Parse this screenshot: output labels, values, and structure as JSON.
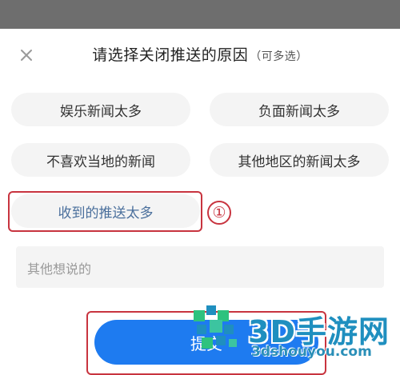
{
  "dialog": {
    "title": "请选择关闭推送的原因",
    "subtitle": "（可多选）",
    "options": [
      {
        "label": "娱乐新闻太多",
        "selected": false
      },
      {
        "label": "负面新闻太多",
        "selected": false
      },
      {
        "label": "不喜欢当地的新闻",
        "selected": false
      },
      {
        "label": "其他地区的新闻太多",
        "selected": false
      },
      {
        "label": "收到的推送太多",
        "selected": true
      }
    ],
    "feedback_placeholder": "其他想说的",
    "submit_label": "提交"
  },
  "annotation": {
    "step_marker": "①",
    "highlight_color": "#c8343f"
  },
  "watermark": {
    "brand": "3D手游网",
    "url": "3dshouyou.com"
  },
  "colors": {
    "accent": "#1e7bf0",
    "selected_text": "#4a6f9c",
    "option_bg": "#f4f4f4"
  }
}
